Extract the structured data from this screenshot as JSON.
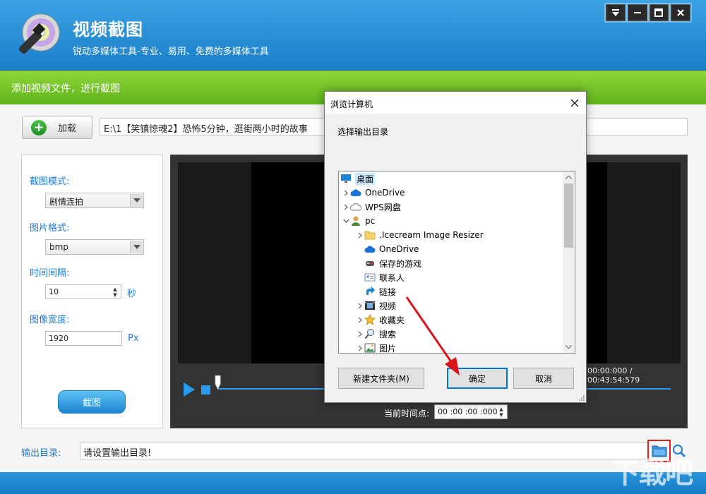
{
  "app": {
    "title": "视频截图",
    "subtitle": "锐动多媒体工具-专业、易用、免费的多媒体工具"
  },
  "banner": {
    "text": "添加视频文件，进行截图"
  },
  "toolbar": {
    "add_label": "加载",
    "file_path": "E:\\1【笑镇惊魂2】恐怖5分钟，逛街两小时的故事"
  },
  "settings": {
    "mode_label": "截图模式:",
    "mode_value": "剧情连拍",
    "format_label": "图片格式:",
    "format_value": "bmp",
    "interval_label": "时间间隔:",
    "interval_value": "10",
    "interval_unit": "秒",
    "width_label": "图像宽度:",
    "width_value": "1920",
    "width_unit": "Px",
    "capture_label": "截图"
  },
  "player": {
    "time_display": "00:00:000 / 00:43:54:579",
    "current_label": "当前时间点:",
    "current_value": "00 :00 :00 :000",
    "progress": 0.0
  },
  "output": {
    "label": "输出目录:",
    "placeholder": "请设置输出目录!"
  },
  "watermark": "下载吧",
  "dialog": {
    "title": "浏览计算机",
    "prompt": "选择输出目录",
    "tree": [
      {
        "label": "桌面",
        "icon": "desktop-icon",
        "level": 0,
        "chevron": "",
        "selected": true
      },
      {
        "label": "OneDrive",
        "icon": "cloud-icon",
        "level": 1,
        "chevron": "right"
      },
      {
        "label": "WPS网盘",
        "icon": "cloud-outline-icon",
        "level": 1,
        "chevron": "right"
      },
      {
        "label": "pc",
        "icon": "user-icon",
        "level": 1,
        "chevron": "down"
      },
      {
        "label": ".Icecream Image Resizer",
        "icon": "folder-icon",
        "level": 2,
        "chevron": "right"
      },
      {
        "label": "OneDrive",
        "icon": "cloud-icon",
        "level": 2,
        "chevron": ""
      },
      {
        "label": "保存的游戏",
        "icon": "games-icon",
        "level": 2,
        "chevron": ""
      },
      {
        "label": "联系人",
        "icon": "contacts-icon",
        "level": 2,
        "chevron": ""
      },
      {
        "label": "链接",
        "icon": "link-icon",
        "level": 2,
        "chevron": ""
      },
      {
        "label": "视频",
        "icon": "video-icon",
        "level": 2,
        "chevron": "right"
      },
      {
        "label": "收藏夹",
        "icon": "star-icon",
        "level": 2,
        "chevron": "right"
      },
      {
        "label": "搜索",
        "icon": "search-icon",
        "level": 2,
        "chevron": "right"
      },
      {
        "label": "图片",
        "icon": "picture-icon",
        "level": 2,
        "chevron": "right"
      }
    ],
    "new_folder_label": "新建文件夹(M)",
    "ok_label": "确定",
    "cancel_label": "取消"
  },
  "colors": {
    "header_blue": "#1b7fc9",
    "banner_green": "#6cc024",
    "label_blue": "#1c7ad0",
    "player_blue": "#2a9cf0",
    "highlight_red": "#e0201a"
  }
}
